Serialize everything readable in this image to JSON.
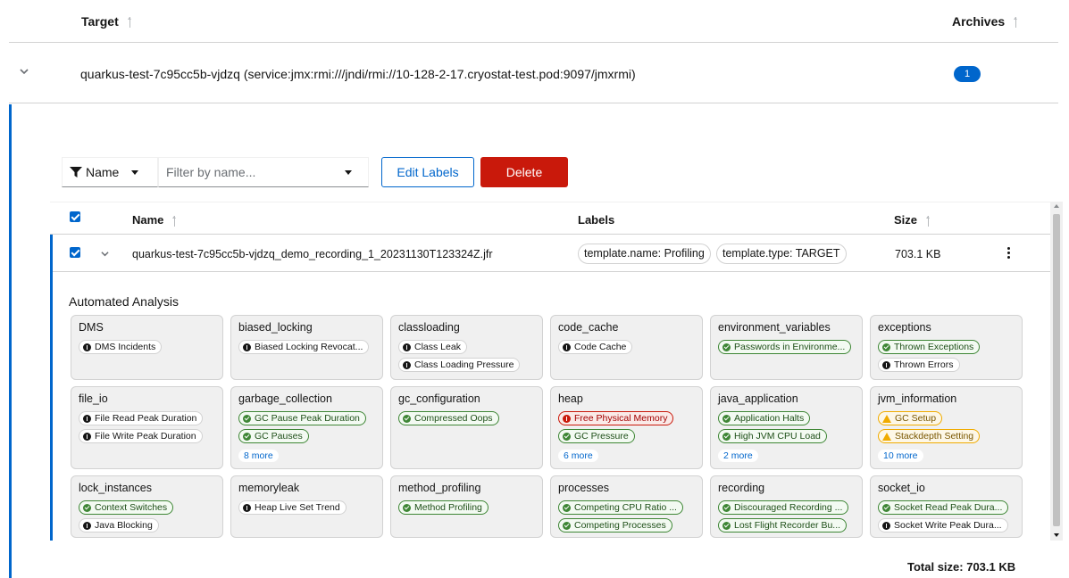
{
  "outer_table": {
    "col_target": "Target",
    "col_archives": "Archives",
    "row": {
      "name": "quarkus-test-7c95cc5b-vjdzq (service:jmx:rmi:///jndi/rmi://10-128-2-17.cryostat-test.pod:9097/jmxrmi)",
      "archives_count": "1"
    }
  },
  "toolbar": {
    "filter_attr": "Name",
    "filter_placeholder": "Filter by name...",
    "edit_labels": "Edit Labels",
    "delete": "Delete"
  },
  "recordings": {
    "col_name": "Name",
    "col_labels": "Labels",
    "col_size": "Size",
    "row": {
      "name": "quarkus-test-7c95cc5b-vjdzq_demo_recording_1_20231130T123324Z.jfr",
      "labels": [
        "template.name: Profiling",
        "template.type: TARGET"
      ],
      "size": "703.1 KB"
    },
    "analysis_title": "Automated Analysis",
    "cards": [
      {
        "title": "DMS",
        "chips": [
          {
            "text": "DMS Incidents",
            "kind": "info"
          }
        ]
      },
      {
        "title": "biased_locking",
        "chips": [
          {
            "text": "Biased Locking Revocat...",
            "kind": "info"
          }
        ]
      },
      {
        "title": "classloading",
        "chips": [
          {
            "text": "Class Leak",
            "kind": "info"
          },
          {
            "text": "Class Loading Pressure",
            "kind": "info"
          }
        ]
      },
      {
        "title": "code_cache",
        "chips": [
          {
            "text": "Code Cache",
            "kind": "info"
          }
        ]
      },
      {
        "title": "environment_variables",
        "chips": [
          {
            "text": "Passwords in Environme...",
            "kind": "ok"
          }
        ]
      },
      {
        "title": "exceptions",
        "chips": [
          {
            "text": "Thrown Exceptions",
            "kind": "ok"
          },
          {
            "text": "Thrown Errors",
            "kind": "info"
          }
        ]
      },
      {
        "title": "file_io",
        "chips": [
          {
            "text": "File Read Peak Duration",
            "kind": "info"
          },
          {
            "text": "File Write Peak Duration",
            "kind": "info"
          }
        ]
      },
      {
        "title": "garbage_collection",
        "chips": [
          {
            "text": "GC Pause Peak Duration",
            "kind": "ok"
          },
          {
            "text": "GC Pauses",
            "kind": "ok"
          }
        ],
        "more": "8 more"
      },
      {
        "title": "gc_configuration",
        "chips": [
          {
            "text": "Compressed Oops",
            "kind": "ok"
          }
        ]
      },
      {
        "title": "heap",
        "chips": [
          {
            "text": "Free Physical Memory",
            "kind": "danger"
          },
          {
            "text": "GC Pressure",
            "kind": "ok"
          }
        ],
        "more": "6 more"
      },
      {
        "title": "java_application",
        "chips": [
          {
            "text": "Application Halts",
            "kind": "ok"
          },
          {
            "text": "High JVM CPU Load",
            "kind": "ok"
          }
        ],
        "more": "2 more"
      },
      {
        "title": "jvm_information",
        "chips": [
          {
            "text": "GC Setup",
            "kind": "warn"
          },
          {
            "text": "Stackdepth Setting",
            "kind": "warn"
          }
        ],
        "more": "10 more"
      },
      {
        "title": "lock_instances",
        "chips": [
          {
            "text": "Context Switches",
            "kind": "ok"
          },
          {
            "text": "Java Blocking",
            "kind": "info"
          }
        ]
      },
      {
        "title": "memoryleak",
        "chips": [
          {
            "text": "Heap Live Set Trend",
            "kind": "info"
          }
        ]
      },
      {
        "title": "method_profiling",
        "chips": [
          {
            "text": "Method Profiling",
            "kind": "ok"
          }
        ]
      },
      {
        "title": "processes",
        "chips": [
          {
            "text": "Competing CPU Ratio ...",
            "kind": "ok"
          },
          {
            "text": "Competing Processes",
            "kind": "ok"
          }
        ]
      },
      {
        "title": "recording",
        "chips": [
          {
            "text": "Discouraged Recording ...",
            "kind": "ok"
          },
          {
            "text": "Lost Flight Recorder Bu...",
            "kind": "ok"
          }
        ]
      },
      {
        "title": "socket_io",
        "chips": [
          {
            "text": "Socket Read Peak Dura...",
            "kind": "ok"
          },
          {
            "text": "Socket Write Peak Dura...",
            "kind": "info"
          }
        ]
      }
    ]
  },
  "footer": {
    "total_size": "Total size: 703.1 KB"
  },
  "colors": {
    "accent": "#0066cc",
    "danger": "#c9190b",
    "success": "#3e8635",
    "warning": "#f0ab00"
  }
}
